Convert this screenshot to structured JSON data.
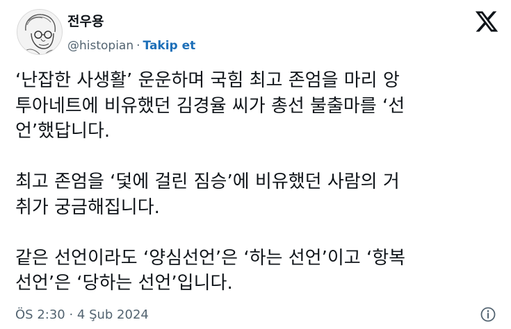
{
  "author": {
    "name": "전우용",
    "handle": "@histopian",
    "separator": "·",
    "follow_label": "Takip et",
    "avatar_icon": "sketch-portrait-avatar"
  },
  "brand": {
    "logo_icon": "x-logo-icon",
    "color": "#0f1419"
  },
  "tweet": {
    "paragraphs": [
      [
        "‘난잡한 사생활’ 운운하며 국힘 최고 존엄을 마리 앙",
        "투아네트에 비유했던 김경율 씨가 총선 불출마를 ‘선",
        "언’했답니다."
      ],
      [
        "최고 존엄을 ‘덫에 걸린 짐승’에 비유했던 사람의 거",
        "취가 궁금해집니다."
      ],
      [
        "같은 선언이라도 ‘양심선언’은 ‘하는 선언’이고 ‘항복",
        "선언’은 ‘당하는 선언’입니다."
      ]
    ]
  },
  "footer": {
    "timestamp": "ÖS 2:30 · 4 Şub 2024",
    "info_icon": "info-icon"
  },
  "colors": {
    "text": "#0f1419",
    "secondary": "#536471",
    "link": "#1d6fb8"
  }
}
